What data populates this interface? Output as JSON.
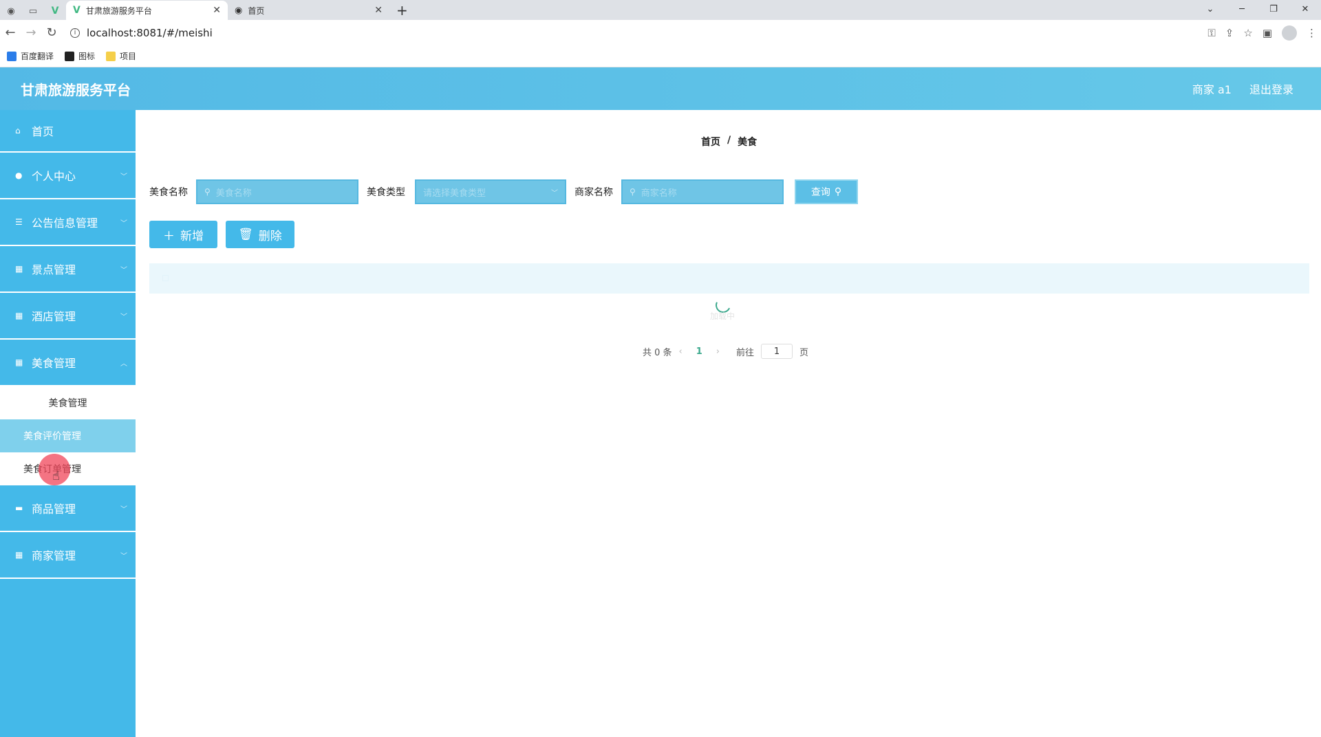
{
  "browser": {
    "tabs": [
      {
        "title": "甘肃旅游服务平台",
        "active": true
      },
      {
        "title": "首页",
        "active": false
      }
    ],
    "url": "localhost:8081/#/meishi",
    "bookmarks": [
      "百度翻译",
      "图标",
      "项目"
    ]
  },
  "app": {
    "title": "甘肃旅游服务平台",
    "user": "商家 a1",
    "logout": "退出登录"
  },
  "sidebar": {
    "items": [
      {
        "label": "首页",
        "icon": "home-icon"
      },
      {
        "label": "个人中心",
        "icon": "user-icon"
      },
      {
        "label": "公告信息管理",
        "icon": "list-icon"
      },
      {
        "label": "景点管理",
        "icon": "grid-icon"
      },
      {
        "label": "酒店管理",
        "icon": "grid-icon"
      },
      {
        "label": "美食管理",
        "icon": "grid-icon"
      },
      {
        "label": "商品管理",
        "icon": "chat-icon"
      },
      {
        "label": "商家管理",
        "icon": "grid-icon"
      }
    ],
    "subitems": [
      "美食管理",
      "美食评价管理",
      "美食订单管理"
    ]
  },
  "main": {
    "breadcrumb": [
      "首页",
      "美食"
    ],
    "breadcrumb_sep": "/",
    "filters": {
      "name_label": "美食名称",
      "name_placeholder": "美食名称",
      "type_label": "美食类型",
      "type_placeholder": "请选择美食类型",
      "shop_label": "商家名称",
      "shop_placeholder": "商家名称",
      "query": "查询"
    },
    "actions": {
      "add": "新增",
      "delete": "删除"
    },
    "loading": "加载中",
    "pagination": {
      "total": "共 0 条",
      "current": "1",
      "goto": "前往",
      "page_input": "1",
      "page_unit": "页"
    }
  },
  "colors": {
    "primary": "#44b9e9",
    "header": "#53b9e6",
    "accent_green": "#3aa88c"
  }
}
